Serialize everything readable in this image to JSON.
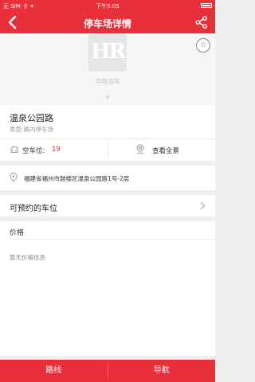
{
  "status_bar": {
    "carrier": "无 SIM 卡 ✦",
    "time": "下午5:05",
    "battery": "✈ ▮"
  },
  "nav": {
    "title": "停车场详情",
    "back_icon": "chevron-left-icon",
    "share_icon": "share-icon"
  },
  "banner": {
    "logo_text": "HR",
    "caption": "华榕泊车",
    "favorite_icon": "star-icon"
  },
  "lot": {
    "name": "温泉公园路",
    "type": "类型:路内停车场",
    "spots_label": "空车位:",
    "spots_value": "19",
    "panorama_label": "查看全景"
  },
  "address": "福建省福州市鼓楼区温泉公园路1号-2层",
  "reserve": {
    "label": "可预约的车位"
  },
  "price": {
    "title": "价格",
    "empty_text": "暂无价格信息"
  },
  "bottom": {
    "route_label": "路线",
    "navigate_label": "导航"
  },
  "colors": {
    "primary": "#e8303a",
    "background": "#efefef"
  }
}
